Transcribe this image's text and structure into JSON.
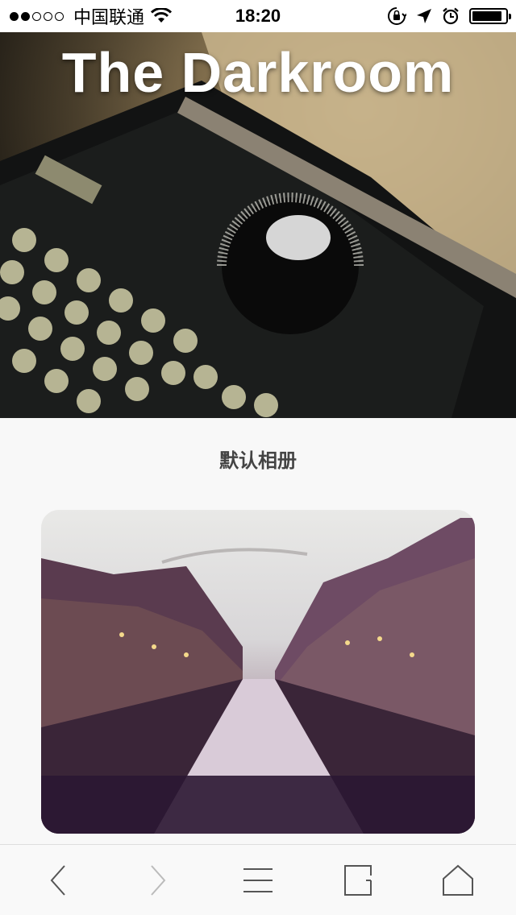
{
  "status_bar": {
    "carrier": "中国联通",
    "time": "18:20",
    "signal_strength": 2,
    "battery_level": 0.9
  },
  "hero": {
    "title": "The Darkroom"
  },
  "album": {
    "title": "默认相册"
  },
  "toolbar": {
    "items": [
      {
        "name": "back",
        "icon": "chevron-left-icon"
      },
      {
        "name": "forward",
        "icon": "chevron-right-icon"
      },
      {
        "name": "menu",
        "icon": "menu-icon"
      },
      {
        "name": "tabs",
        "icon": "tabs-icon"
      },
      {
        "name": "home",
        "icon": "home-icon"
      }
    ]
  },
  "colors": {
    "status_bar_bg": "#ffffff",
    "page_bg": "#f8f8f8",
    "toolbar_icon": "#555555",
    "toolbar_icon_disabled": "#bbbbbb"
  }
}
